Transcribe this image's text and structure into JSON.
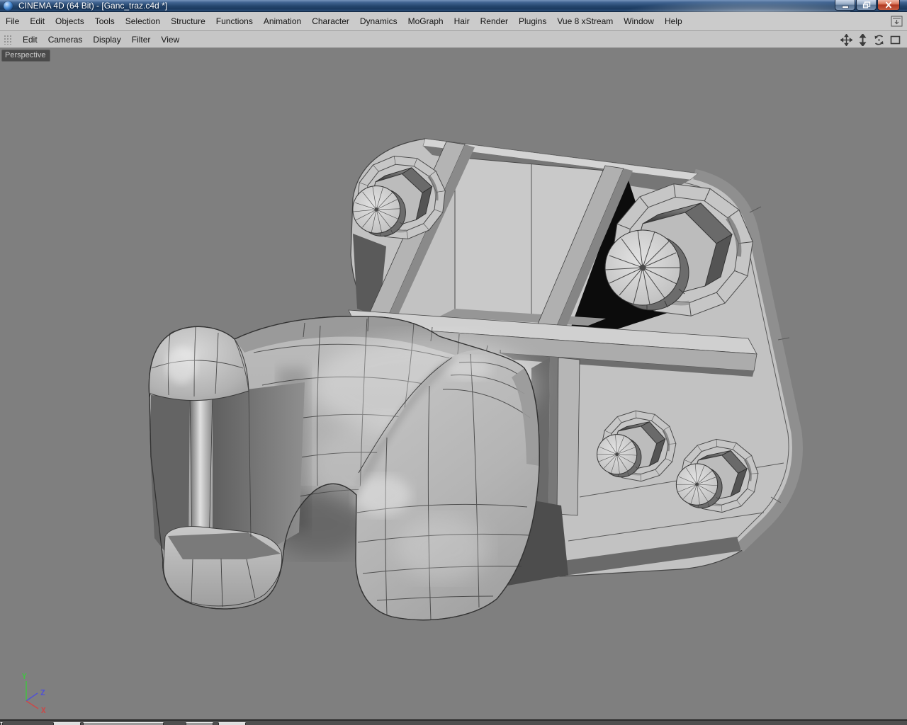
{
  "window": {
    "app_icon": "cinema4d-app-icon",
    "title": "CINEMA 4D (64 Bit) - [Ganc_traz.c4d *]",
    "controls": {
      "minimize": "minimize",
      "restore": "restore",
      "close": "close"
    }
  },
  "menu_bar": {
    "items": [
      "File",
      "Edit",
      "Objects",
      "Tools",
      "Selection",
      "Structure",
      "Functions",
      "Animation",
      "Character",
      "Dynamics",
      "MoGraph",
      "Hair",
      "Render",
      "Plugins",
      "Vue 8 xStream",
      "Window",
      "Help"
    ]
  },
  "viewport_toolbar": {
    "menus": [
      "Edit",
      "Cameras",
      "Display",
      "Filter",
      "View"
    ],
    "nav_tools": [
      "pan",
      "dolly",
      "rotate",
      "maximize"
    ]
  },
  "viewport": {
    "camera_label": "Perspective",
    "background_color": "#7f7f7f",
    "model_description": "Tow-hitch polygon model (mounting plate with four bolts, gusset ribs and pintle hook) shown shaded with wireframe",
    "axis_gizmo": {
      "x": {
        "label": "X",
        "color": "#cc4848"
      },
      "y": {
        "label": "Y",
        "color": "#44c044"
      },
      "z": {
        "label": "Z",
        "color": "#5252d2"
      }
    }
  }
}
